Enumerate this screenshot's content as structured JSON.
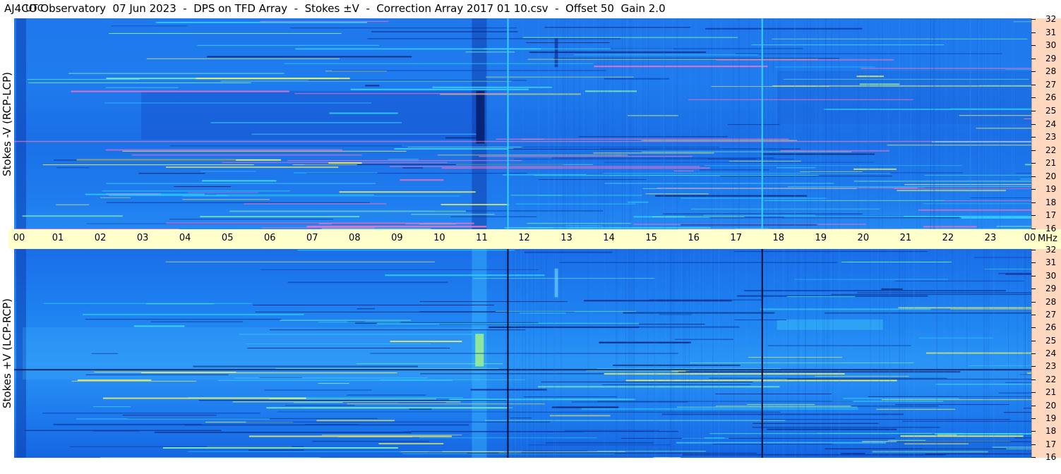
{
  "title": "AJ4CO Observatory  07 Jun 2023  -  DPS on TFD Array  -  Stokes ±V  -  Correction Array 2017 01 10.csv  -  Offset 50  Gain 2.0",
  "colors": {
    "time_strip": "#ffffcc",
    "freq_column": "#ffd8bf",
    "base_blue": "#1f7ef0",
    "dark_blue": "#0a2a8c",
    "cyan": "#2ad0ff",
    "yellow": "#f0f060"
  },
  "chart_data": {
    "type": "heatmap",
    "x_axis": {
      "unit": "UTC",
      "tick_labels": [
        "00",
        "01",
        "02",
        "03",
        "04",
        "05",
        "06",
        "07",
        "08",
        "09",
        "10",
        "11",
        "12",
        "13",
        "14",
        "15",
        "16",
        "17",
        "18",
        "19",
        "20",
        "21",
        "22",
        "23",
        "00"
      ],
      "range_hours": [
        0,
        24
      ]
    },
    "y_axis": {
      "unit": "MHz",
      "tick_labels": [
        "32",
        "31",
        "30",
        "29",
        "28",
        "27",
        "26",
        "25",
        "24",
        "23",
        "22",
        "21",
        "20",
        "19",
        "18",
        "17",
        "16"
      ],
      "range_mhz": [
        16,
        32
      ]
    },
    "panels": [
      {
        "ylabel": "Stokes -V (RCP-LCP)",
        "colormap": "blue-cyan-yellow",
        "notable_features": {
          "vertical_lines_utc": [
            11.65,
            17.65
          ],
          "vertical_line_color": "cyan",
          "dark_burst_utc": 11.0,
          "dark_burst_mhz": [
            22.5,
            26.5
          ],
          "bright_line_mhz": 22.7
        }
      },
      {
        "ylabel": "Stokes +V (LCP-RCP)",
        "colormap": "blue-cyan-yellow",
        "notable_features": {
          "vertical_lines_utc": [
            11.65,
            17.65
          ],
          "vertical_line_color": "black",
          "bright_burst_utc": 11.0,
          "bright_burst_mhz": [
            23.0,
            25.5
          ],
          "dark_line_mhz": 22.8
        }
      }
    ]
  }
}
